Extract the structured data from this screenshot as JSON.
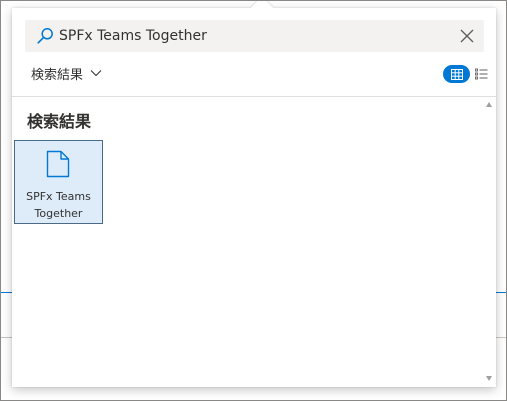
{
  "search": {
    "value": "SPFx Teams Together",
    "icon": "search-icon",
    "clear_icon": "close-icon"
  },
  "scope": {
    "label": "検索結果",
    "icon": "chevron-down-icon"
  },
  "view_toggle": {
    "grid_icon": "grid-view-icon",
    "list_icon": "list-view-icon",
    "active": "grid",
    "accent_color": "#0078d4"
  },
  "results": {
    "heading": "検索結果",
    "items": [
      {
        "line1": "SPFx Teams",
        "line2": "Together",
        "icon": "document-icon",
        "selected": true
      }
    ]
  },
  "colors": {
    "accent": "#0078d4",
    "search_bg": "#f3f2f1",
    "tile_selected_bg": "#deecf9"
  }
}
